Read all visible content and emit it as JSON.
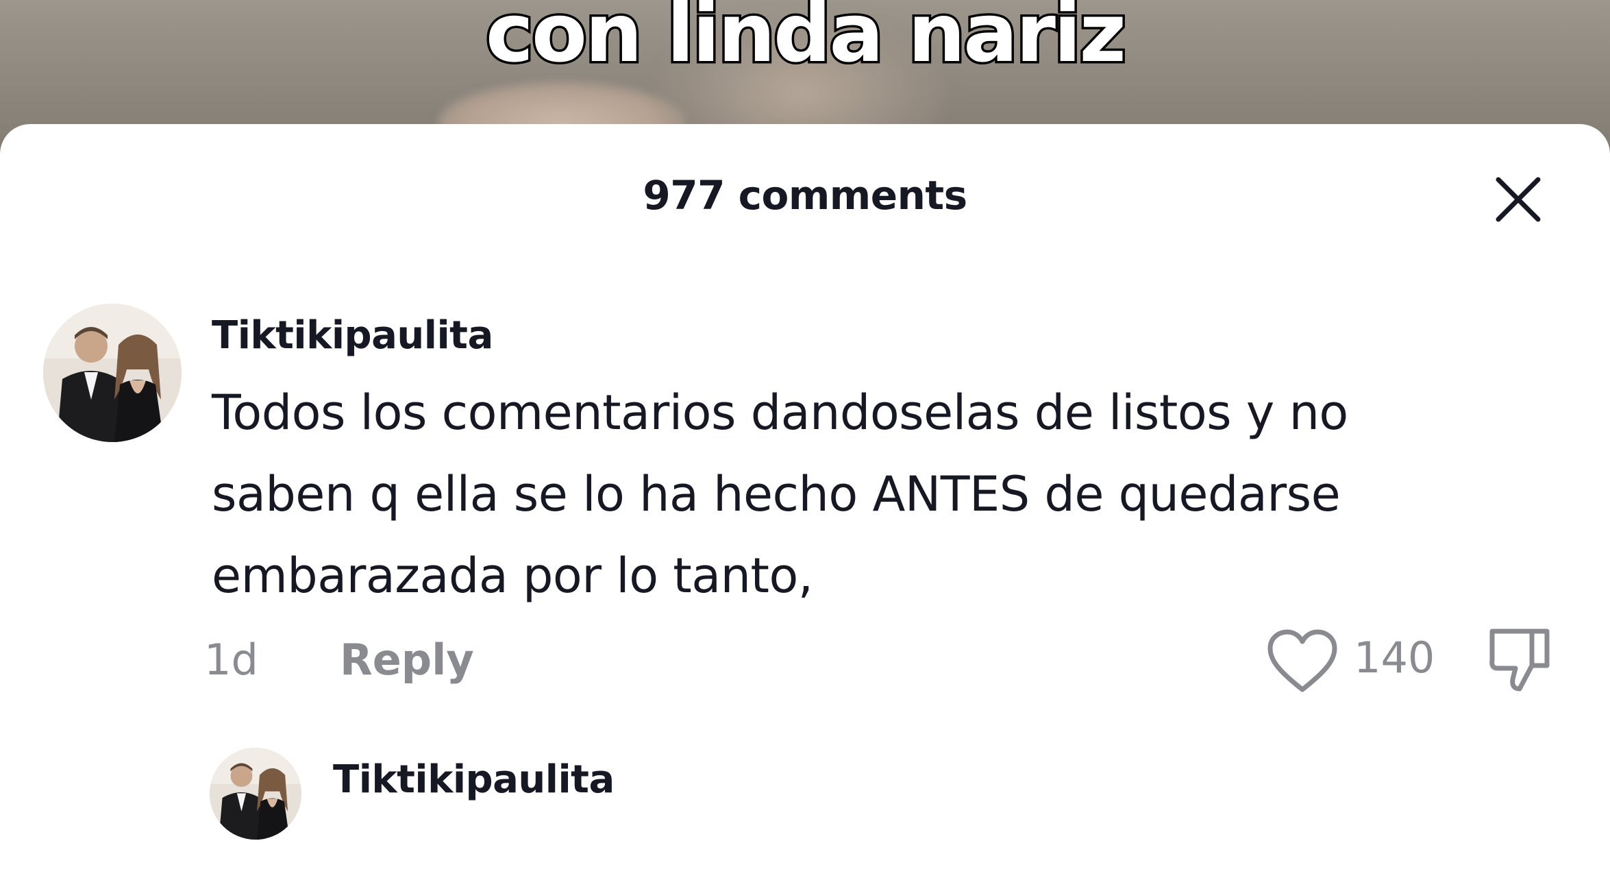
{
  "video": {
    "caption": "con linda nariz"
  },
  "comments_panel": {
    "title": "977 comments",
    "close_icon": "close-icon",
    "comments": [
      {
        "username": "Tiktikipaulita",
        "text_lines": [
          "Todos los comentarios dandoselas de listos y no",
          "saben q ella se lo ha hecho ANTES de quedarse",
          "embarazada por lo tanto,"
        ],
        "time": "1d",
        "reply_label": "Reply",
        "like_count": "140",
        "like_icon": "heart-icon",
        "dislike_icon": "thumbs-down-icon"
      },
      {
        "username": "Tiktikipaulita"
      }
    ]
  },
  "colors": {
    "text_primary": "#161823",
    "text_secondary": "#8a8b91",
    "sheet_background": "#ffffff"
  }
}
